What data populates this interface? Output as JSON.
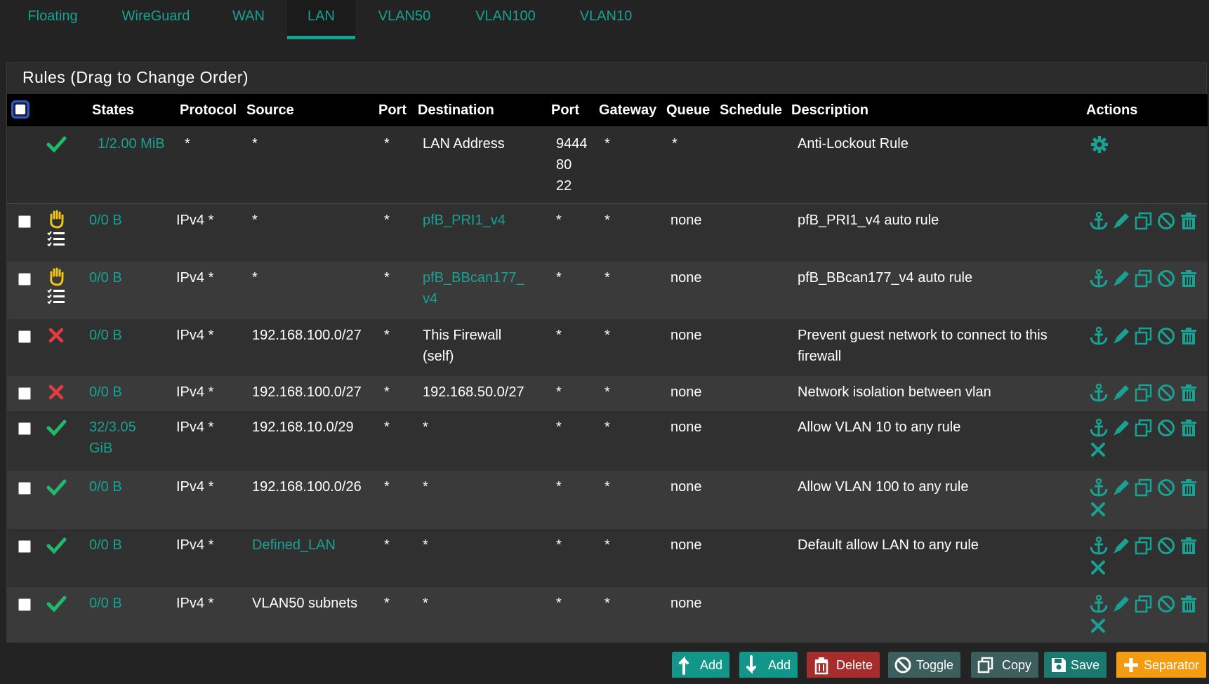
{
  "tabs": [
    {
      "label": "Floating"
    },
    {
      "label": "WireGuard"
    },
    {
      "label": "WAN"
    },
    {
      "label": "LAN"
    },
    {
      "label": "VLAN50"
    },
    {
      "label": "VLAN100"
    },
    {
      "label": "VLAN10"
    }
  ],
  "active_tab": "LAN",
  "panel": {
    "title": "Rules (Drag to Change Order)"
  },
  "columns": {
    "states": "States",
    "protocol": "Protocol",
    "source": "Source",
    "src_port": "Port",
    "destination": "Destination",
    "dst_port": "Port",
    "gateway": "Gateway",
    "queue": "Queue",
    "schedule": "Schedule",
    "description": "Description",
    "actions": "Actions"
  },
  "anti_lockout": {
    "states": "1/2.00 MiB",
    "protocol": "*",
    "source": "*",
    "src_port": "*",
    "destination": "LAN Address",
    "dst_port_1": "9444",
    "dst_port_2": "80",
    "dst_port_3": "22",
    "gateway": "*",
    "queue": "*",
    "description": "Anti-Lockout Rule"
  },
  "rules": [
    {
      "status": "block-hand",
      "states": "0/0 B",
      "protocol": "IPv4 *",
      "source": "*",
      "src_port": "*",
      "destination_1": "pfB_PRI1_v4",
      "destination_2": "",
      "dst_port": "*",
      "gateway": "*",
      "queue": "none",
      "description_1": "pfB_PRI1_v4 auto rule",
      "description_2": ""
    },
    {
      "status": "block-hand",
      "states": "0/0 B",
      "protocol": "IPv4 *",
      "source": "*",
      "src_port": "*",
      "destination_1": "pfB_BBcan177_",
      "destination_2": "v4",
      "dst_port": "*",
      "gateway": "*",
      "queue": "none",
      "description_1": "pfB_BBcan177_v4 auto rule",
      "description_2": ""
    },
    {
      "status": "reject",
      "states": "0/0 B",
      "protocol": "IPv4 *",
      "source": "192.168.100.0/27",
      "src_port": "*",
      "destination_1": "This Firewall",
      "destination_2": "(self)",
      "dst_port": "*",
      "gateway": "*",
      "queue": "none",
      "description_1": "Prevent guest network to connect to this",
      "description_2": "firewall"
    },
    {
      "status": "reject",
      "states": "0/0 B",
      "protocol": "IPv4 *",
      "source": "192.168.100.0/27",
      "src_port": "*",
      "destination_1": "192.168.50.0/27",
      "destination_2": "",
      "dst_port": "*",
      "gateway": "*",
      "queue": "none",
      "description_1": "Network isolation between vlan",
      "description_2": ""
    },
    {
      "status": "pass",
      "states": "32/3.05",
      "states_2": "GiB",
      "protocol": "IPv4 *",
      "source": "192.168.10.0/29",
      "src_port": "*",
      "destination_1": "*",
      "destination_2": "",
      "dst_port": "*",
      "gateway": "*",
      "queue": "none",
      "description_1": "Allow VLAN 10 to any rule",
      "description_2": ""
    },
    {
      "status": "pass",
      "states": "0/0 B",
      "protocol": "IPv4 *",
      "source": "192.168.100.0/26",
      "src_port": "*",
      "destination_1": "*",
      "destination_2": "",
      "dst_port": "*",
      "gateway": "*",
      "queue": "none",
      "description_1": "Allow VLAN 100 to any rule",
      "description_2": ""
    },
    {
      "status": "pass",
      "states": "0/0 B",
      "protocol": "IPv4 *",
      "source": "Defined_LAN",
      "src_port": "*",
      "destination_1": "*",
      "destination_2": "",
      "dst_port": "*",
      "gateway": "*",
      "queue": "none",
      "description_1": "Default allow LAN to any rule",
      "description_2": ""
    },
    {
      "status": "pass",
      "states": "0/0 B",
      "protocol": "IPv4 *",
      "source": "VLAN50 subnets",
      "src_port": "*",
      "destination_1": "*",
      "destination_2": "",
      "dst_port": "*",
      "gateway": "*",
      "queue": "none",
      "description_1": "",
      "description_2": ""
    }
  ],
  "buttons": {
    "add_top": "Add",
    "add_bottom": "Add",
    "delete": "Delete",
    "toggle": "Toggle",
    "copy": "Copy",
    "save": "Save",
    "separator": "Separator"
  },
  "colors": {
    "accent": "#19a193",
    "pass": "#1fba6c",
    "reject": "#e53a40",
    "block": "#f0c419",
    "danger": "#c9302c",
    "warning": "#f39c12"
  }
}
